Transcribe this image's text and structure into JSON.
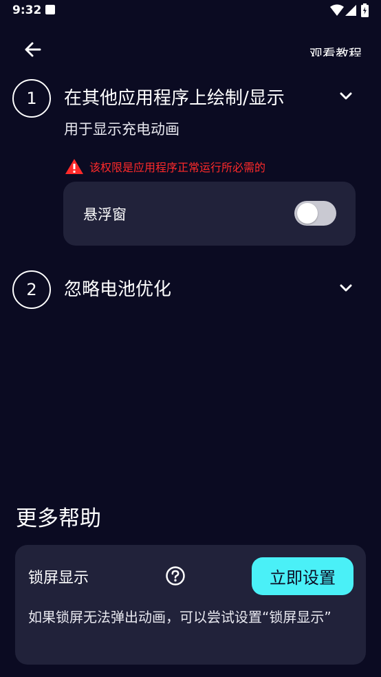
{
  "status_bar": {
    "time": "9:32",
    "icons": [
      "notification-icon",
      "wifi-icon",
      "signal-icon",
      "battery-charging-icon"
    ]
  },
  "app_bar": {
    "back_icon": "arrow-left-icon",
    "tutorial_label": "观看教程"
  },
  "steps": [
    {
      "number": "1",
      "title": "在其他应用程序上绘制/显示",
      "subtitle": "用于显示充电动画",
      "expand_icon": "chevron-down-icon",
      "warning": {
        "icon": "warning-triangle-icon",
        "text": "该权限是应用程序正常运行所必需的"
      },
      "permission": {
        "label": "悬浮窗",
        "enabled": false
      }
    },
    {
      "number": "2",
      "title": "忽略电池优化",
      "expand_icon": "chevron-down-icon"
    }
  ],
  "more_help": {
    "heading": "更多帮助",
    "lock_screen": {
      "title": "锁屏显示",
      "help_icon": "question-circle-icon",
      "button_label": "立即设置",
      "description": "如果锁屏无法弹出动画，可以尝试设置“锁屏显示”"
    }
  },
  "colors": {
    "background": "#0b0b22",
    "card": "#21223a",
    "accent": "#4af0f7",
    "warning": "#ff2a2a",
    "toggle_off": "#c9c9d2"
  }
}
